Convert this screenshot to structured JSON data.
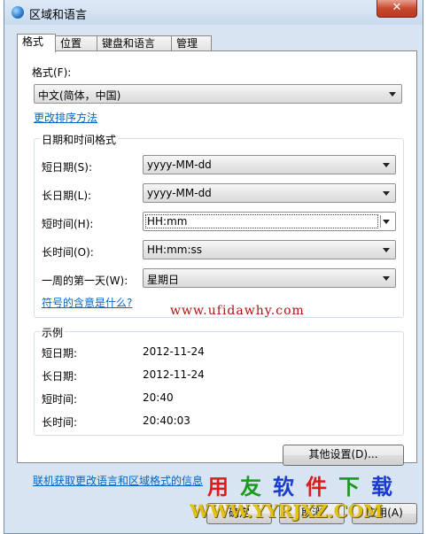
{
  "window": {
    "title": "区域和语言",
    "close_glyph": "✕"
  },
  "tabs": [
    "格式",
    "位置",
    "键盘和语言",
    "管理"
  ],
  "format": {
    "label": "格式(F):",
    "value": "中文(简体，中国)",
    "change_sort_link": "更改排序方法"
  },
  "datetime": {
    "group_title": "日期和时间格式",
    "short_date_label": "短日期(S):",
    "short_date_value": "yyyy-MM-dd",
    "long_date_label": "长日期(L):",
    "long_date_value": "yyyy-MM-dd",
    "short_time_label": "短时间(H):",
    "short_time_value": "HH:mm",
    "long_time_label": "长时间(O):",
    "long_time_value": "HH:mm:ss",
    "first_day_label": "一周的第一天(W):",
    "first_day_value": "星期日",
    "symbols_link": "符号的含意是什么?"
  },
  "examples": {
    "group_title": "示例",
    "rows": [
      {
        "label": "短日期:",
        "value": "2012-11-24"
      },
      {
        "label": "长日期:",
        "value": "2012-11-24"
      },
      {
        "label": "短时间:",
        "value": "20:40"
      },
      {
        "label": "长时间:",
        "value": "20:40:03"
      }
    ]
  },
  "other_settings_button": "其他设置(D)...",
  "online_link": "联机获取更改语言和区域格式的信息",
  "buttons": {
    "ok": "确定",
    "cancel": "取消",
    "apply": "应用(A)"
  },
  "watermarks": {
    "url": "www.ufidawhy.com",
    "brand_chars": [
      "用",
      "友",
      "软",
      "件",
      "下",
      "载"
    ],
    "brand_colors": [
      "#e01a1a",
      "#1a9a1a",
      "#1a3ad0",
      "#e01a1a",
      "#1a9a1a",
      "#1a3ad0"
    ],
    "site": "WWW.YYRJXZ.COM"
  }
}
